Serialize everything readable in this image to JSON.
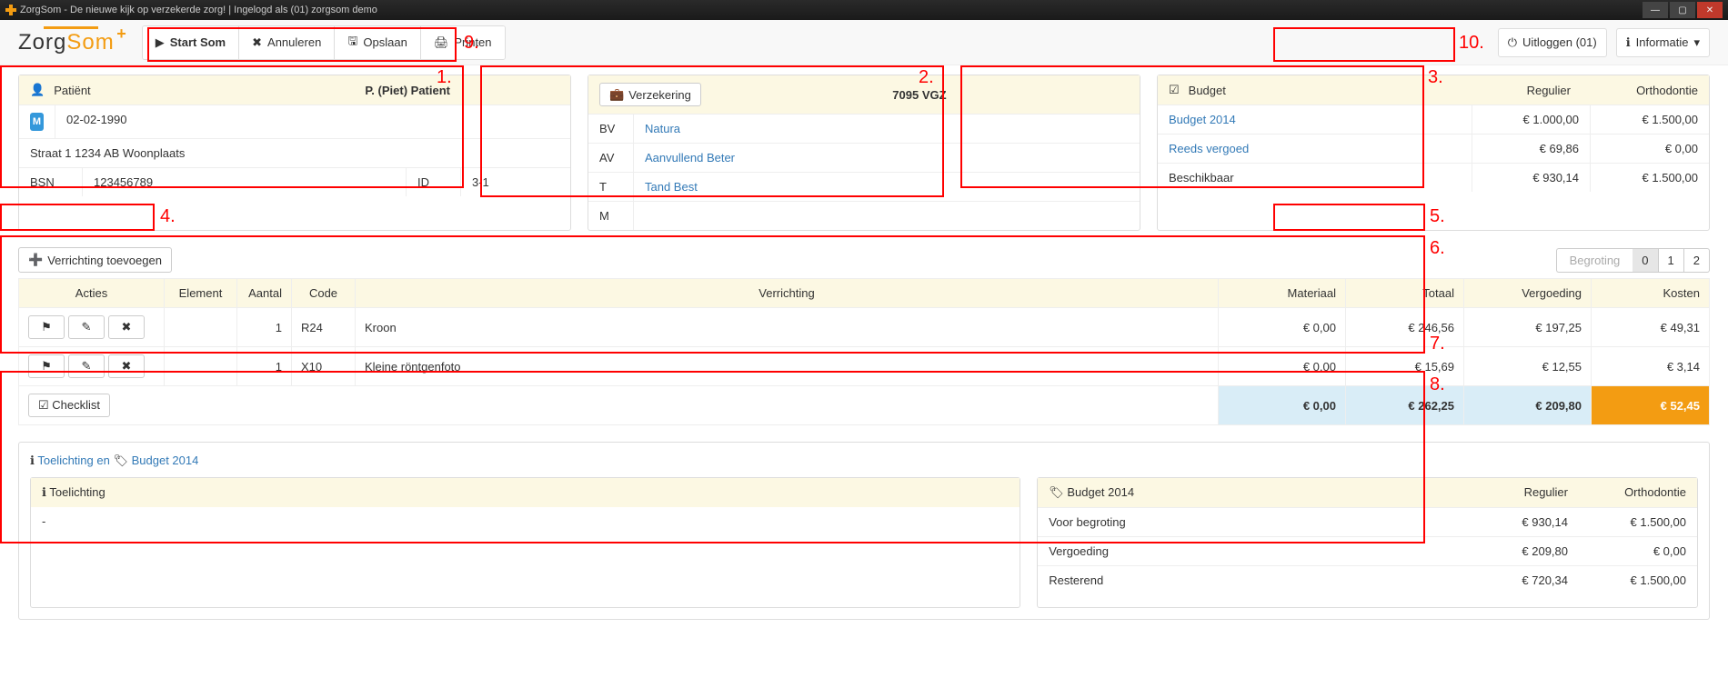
{
  "window": {
    "title": "ZorgSom - De nieuwe kijk op verzekerde zorg! | Ingelogd als (01) zorgsom demo"
  },
  "brand": {
    "t1": "Zorg",
    "t2": "Som"
  },
  "nav": {
    "start": "Start Som",
    "cancel": "Annuleren",
    "save": "Opslaan",
    "print": "Printen",
    "logout": "Uitloggen (01)",
    "info": "Informatie"
  },
  "patient": {
    "header_label": "Patiënt",
    "name": "P. (Piet) Patient",
    "gender_letter": "M",
    "dob": "02-02-1990",
    "address": "Straat 1 1234 AB Woonplaats",
    "bsn_label": "BSN",
    "bsn": "123456789",
    "id_label": "ID",
    "id": "3-1"
  },
  "insurance": {
    "button": "Verzekering",
    "title": "7095 VGZ",
    "rows": [
      {
        "k": "BV",
        "v": "Natura"
      },
      {
        "k": "AV",
        "v": "Aanvullend Beter"
      },
      {
        "k": "T",
        "v": "Tand Best"
      },
      {
        "k": "M",
        "v": ""
      }
    ]
  },
  "budget_panel": {
    "h1": "Budget",
    "h2": "Regulier",
    "h3": "Orthodontie",
    "rows": [
      {
        "label": "Budget 2014",
        "r": "€ 1.000,00",
        "o": "€ 1.500,00",
        "link": true
      },
      {
        "label": "Reeds vergoed",
        "r": "€ 69,86",
        "o": "€ 0,00",
        "link": true
      },
      {
        "label": "Beschikbaar",
        "r": "€ 930,14",
        "o": "€ 1.500,00",
        "link": false
      }
    ]
  },
  "actions": {
    "add": "Verrichting toevoegen",
    "begroting": "Begroting",
    "pages": [
      "0",
      "1",
      "2"
    ],
    "active": "0"
  },
  "table": {
    "headers": {
      "acties": "Acties",
      "element": "Element",
      "aantal": "Aantal",
      "code": "Code",
      "verrichting": "Verrichting",
      "materiaal": "Materiaal",
      "totaal": "Totaal",
      "vergoeding": "Vergoeding",
      "kosten": "Kosten"
    },
    "rows": [
      {
        "aantal": "1",
        "code": "R24",
        "verrichting": "Kroon",
        "materiaal": "€ 0,00",
        "totaal": "€ 246,56",
        "vergoeding": "€ 197,25",
        "kosten": "€ 49,31"
      },
      {
        "aantal": "1",
        "code": "X10",
        "verrichting": "Kleine röntgenfoto",
        "materiaal": "€ 0,00",
        "totaal": "€ 15,69",
        "vergoeding": "€ 12,55",
        "kosten": "€ 3,14"
      }
    ],
    "checklist": "Checklist",
    "totals": {
      "materiaal": "€ 0,00",
      "totaal": "€ 262,25",
      "vergoeding": "€ 209,80",
      "kosten": "€ 52,45"
    }
  },
  "info": {
    "link1": "Toelichting en",
    "link2": "Budget 2014",
    "toelichting_header": "Toelichting",
    "toelichting_body": "-",
    "b_header": "Budget 2014",
    "b_h2": "Regulier",
    "b_h3": "Orthodontie",
    "brows": [
      {
        "l": "Voor begroting",
        "r": "€ 930,14",
        "o": "€ 1.500,00"
      },
      {
        "l": "Vergoeding",
        "r": "€ 209,80",
        "o": "€ 0,00"
      },
      {
        "l": "Resterend",
        "r": "€ 720,34",
        "o": "€ 1.500,00"
      }
    ]
  },
  "annotations": [
    "1.",
    "2.",
    "3.",
    "4.",
    "5.",
    "6.",
    "7.",
    "8.",
    "9.",
    "10."
  ]
}
